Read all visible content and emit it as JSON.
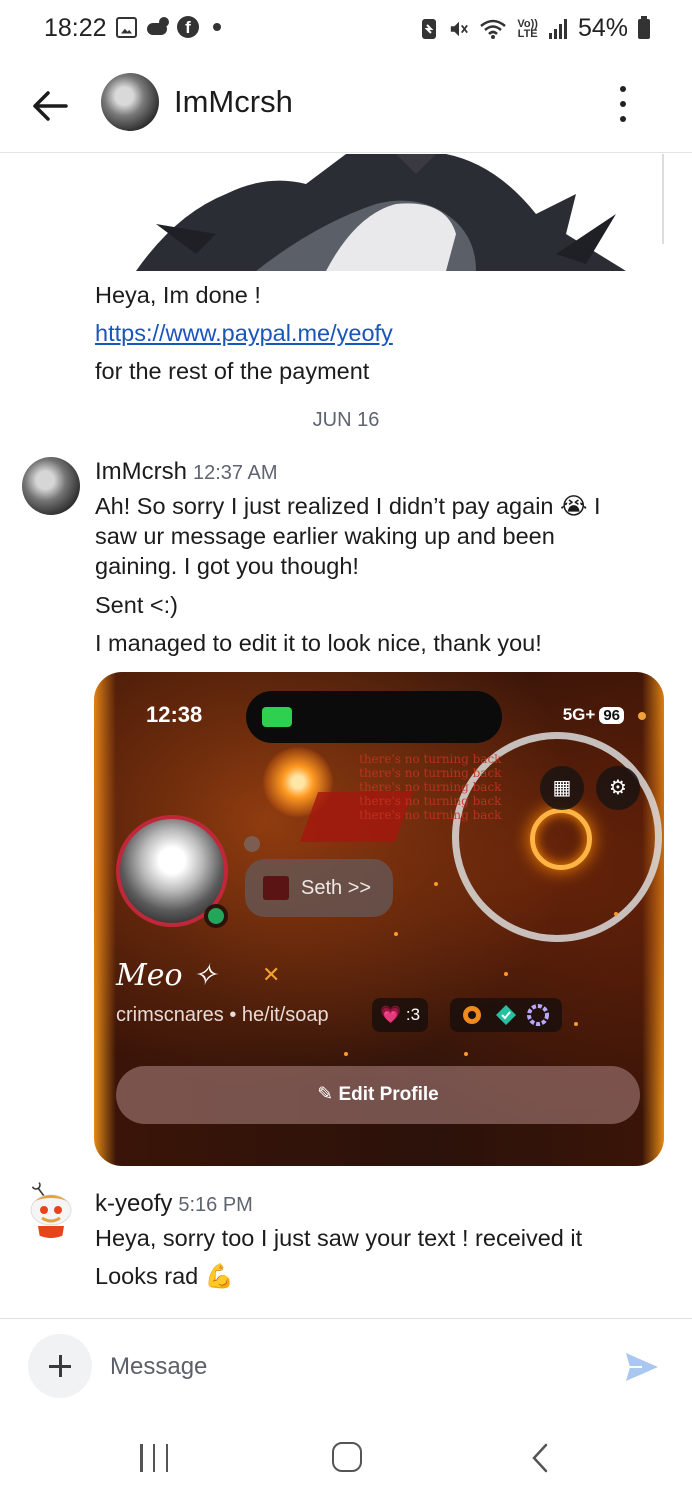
{
  "status_bar": {
    "time": "18:22",
    "battery": "54%",
    "lte_top": "Vo))",
    "lte_bottom": "LTE",
    "fb_letter": "f"
  },
  "header": {
    "title": "ImMcrsh"
  },
  "messages": {
    "intro_lines": [
      "Heya, Im done !",
      "https://www.paypal.me/yeofy",
      "for the rest of the payment"
    ],
    "date_separator": "JUN 16",
    "group1": {
      "author": "ImMcrsh",
      "time": "12:37 AM",
      "line1": "Ah! So sorry I just realized I didn’t pay again 😭 I saw ur message earlier waking up and been gaining. I got you though!",
      "line2": "Sent <:)",
      "line3": "I managed to edit it to look nice, thank you!"
    },
    "group2": {
      "author": "k-yeofy",
      "time": "5:16 PM",
      "line1": "Heya, sorry too I just saw your text ! received it",
      "line2": "Looks rad 💪"
    }
  },
  "screenshot": {
    "time": "12:38",
    "network": "5G+",
    "battery": "96",
    "chip_label": "Seth >>",
    "display_name": "Meo ✧",
    "subtitle": "crimscnares • he/it/soap",
    "badge_heart": "💗 :3",
    "edit_button": "✎ Edit Profile",
    "overlay_text": "there's no turning back\nthere's no turning back\nthere's no turning back\nthere's no turning back\nthere's no turning back"
  },
  "composer": {
    "placeholder": "Message"
  }
}
